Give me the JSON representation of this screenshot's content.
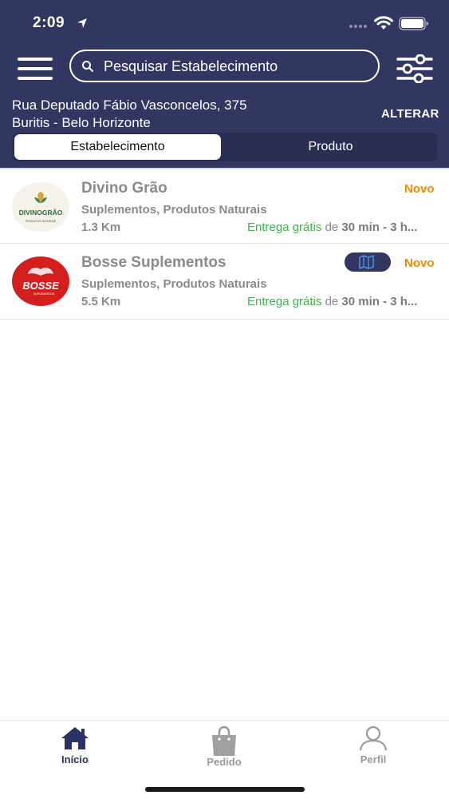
{
  "status_bar": {
    "time": "2:09"
  },
  "header": {
    "search_placeholder": "Pesquisar Estabelecimento",
    "address_line1": "Rua Deputado Fábio Vasconcelos, 375",
    "address_line2": "Buritis - Belo Horizonte",
    "change_label": "ALTERAR"
  },
  "tabs": {
    "establishment": "Estabelecimento",
    "product": "Produto",
    "selected": "Estabelecimento"
  },
  "stores": [
    {
      "name": "Divino Grão",
      "categories": "Suplementos, Produtos Naturais",
      "distance": "1.3 Km",
      "badge": "Novo",
      "delivery_free": "Entrega grátis",
      "delivery_connector": "de",
      "delivery_time": "30 min - 3 h...",
      "logo_text": "DIVINOGRÃO",
      "logo_subtext": "PRODUTOS NATURAIS"
    },
    {
      "name": "Bosse Suplementos",
      "categories": "Suplementos, Produtos Naturais",
      "distance": "5.5 Km",
      "badge": "Novo",
      "delivery_free": "Entrega grátis",
      "delivery_connector": "de",
      "delivery_time": "30 min - 3 h...",
      "logo_text": "BOSSE",
      "logo_subtext": "SUPLEMENTOS"
    }
  ],
  "bottom_nav": {
    "home": "Início",
    "orders": "Pedido",
    "profile": "Perfil",
    "active": "Início"
  },
  "colors": {
    "header_bg": "#323762",
    "new_badge": "#f08a00",
    "free_delivery": "#3fb24a",
    "active_tab": "#2c3263",
    "inactive_tab": "#9a9a9a"
  },
  "icons": [
    "location-arrow-icon",
    "signal-icon",
    "wifi-icon",
    "battery-icon",
    "menu-icon",
    "search-icon",
    "filter-sliders-icon",
    "map-icon",
    "home-icon",
    "shopping-bag-icon",
    "person-icon"
  ]
}
